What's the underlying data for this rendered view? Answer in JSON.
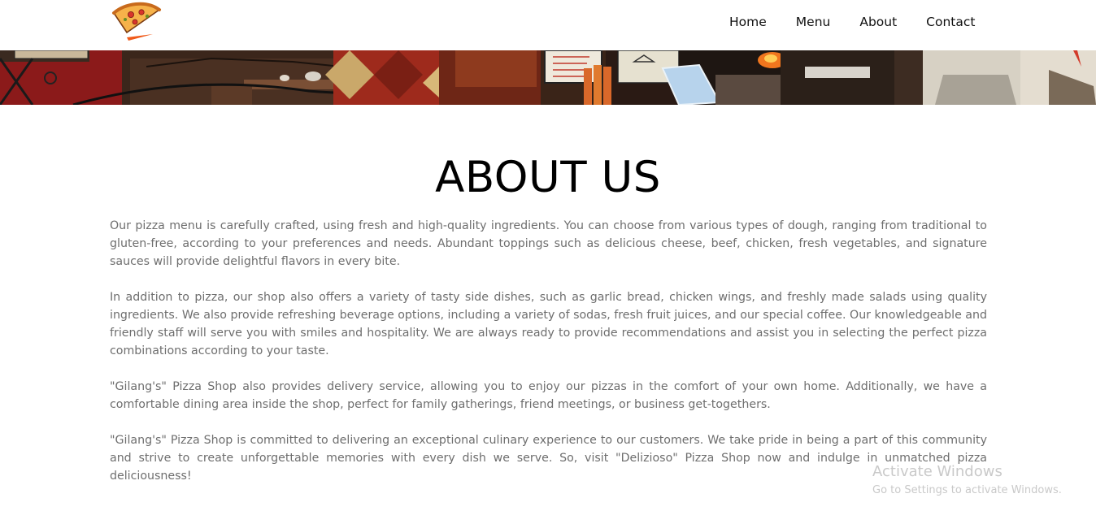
{
  "nav": {
    "logo_icon": "pizza-slice-logo",
    "items": [
      {
        "label": "Home"
      },
      {
        "label": "Menu"
      },
      {
        "label": "About"
      },
      {
        "label": "Contact"
      }
    ]
  },
  "about": {
    "title": "ABOUT US",
    "paragraphs": [
      "Our pizza menu is carefully crafted, using fresh and high-quality ingredients. You can choose from various types of dough, ranging from traditional to gluten-free, according to your preferences and needs. Abundant toppings such as delicious cheese, beef, chicken, fresh vegetables, and signature sauces will provide delightful flavors in every bite.",
      "In addition to pizza, our shop also offers a variety of tasty side dishes, such as garlic bread, chicken wings, and freshly made salads using quality ingredients. We also provide refreshing beverage options, including a variety of sodas, fresh fruit juices, and our special coffee. Our knowledgeable and friendly staff will serve you with smiles and hospitality. We are always ready to provide recommendations and assist you in selecting the perfect pizza combinations according to your taste.",
      "\"Gilang's\" Pizza Shop also provides delivery service, allowing you to enjoy our pizzas in the comfort of your own home. Additionally, we have a comfortable dining area inside the shop, perfect for family gatherings, friend meetings, or business get-togethers.",
      "\"Gilang's\" Pizza Shop is committed to delivering an exceptional culinary experience to our customers. We take pride in being a part of this community and strive to create unforgettable memories with every dish we serve. So, visit \"Delizioso\" Pizza Shop now and indulge in unmatched pizza deliciousness!"
    ]
  },
  "watermark": {
    "title": "Activate Windows",
    "subtitle": "Go to Settings to activate Windows."
  }
}
